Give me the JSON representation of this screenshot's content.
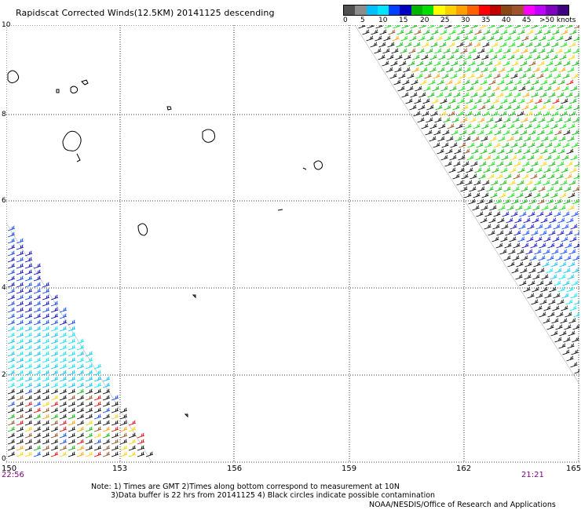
{
  "title": "Rapidscat Corrected Winds(12.5KM) 20141125 descending",
  "colorbar": {
    "labels": [
      "0",
      "5",
      "10",
      "15",
      "20",
      "25",
      "30",
      "35",
      "40",
      "45",
      ">50 knots"
    ],
    "colors": [
      "#505050",
      "#8c8c8c",
      "#00bfff",
      "#00e5ff",
      "#0040ff",
      "#0000c0",
      "#00b400",
      "#00e000",
      "#ffff00",
      "#ffd000",
      "#ffa000",
      "#ff6000",
      "#ff0000",
      "#c00000",
      "#8b4513",
      "#a0522d",
      "#ff00ff",
      "#c000ff",
      "#8000c0",
      "#400080"
    ]
  },
  "axes": {
    "latitudes": [
      "10",
      "8",
      "6",
      "4",
      "2",
      "0"
    ],
    "longitudes": [
      "150",
      "153",
      "156",
      "159",
      "162",
      "165"
    ]
  },
  "times": {
    "left": "22:56",
    "right": "21:21"
  },
  "notes": [
    "Note: 1) Times are GMT 2)Times along bottom correspond to measurement at 10N",
    "3)Data buffer is 22 hrs from 20141125 4) Black circles indicate possible contamination"
  ],
  "credit": "NOAA/NESDIS/Office of Research and Applications"
}
